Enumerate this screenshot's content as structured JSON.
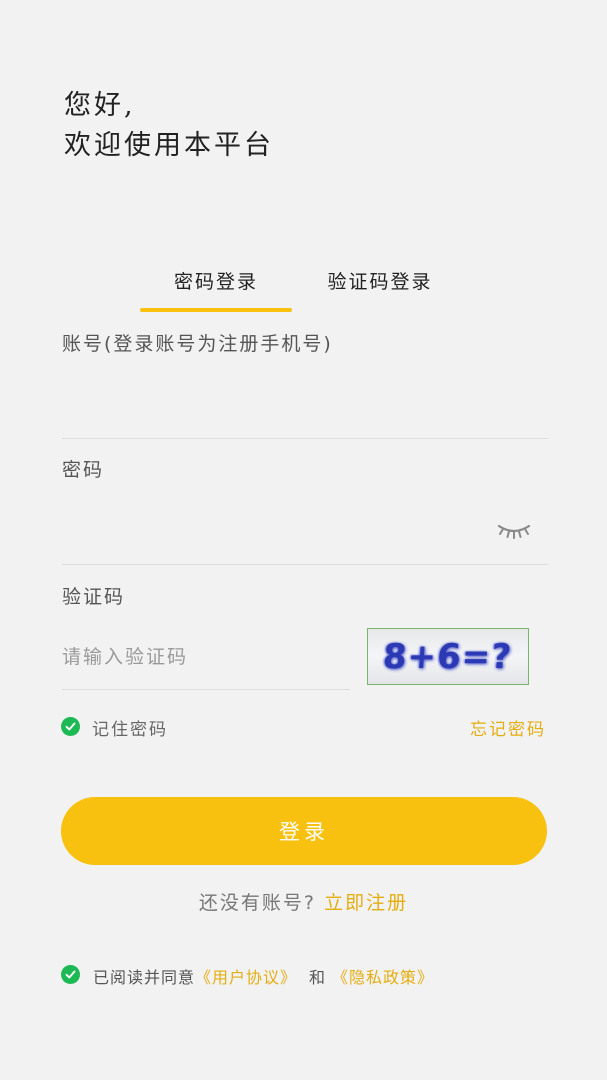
{
  "greeting": {
    "line1": "您好,",
    "line2": "欢迎使用本平台"
  },
  "tabs": [
    {
      "label": "密码登录",
      "active": true
    },
    {
      "label": "验证码登录",
      "active": false
    }
  ],
  "account": {
    "label": "账号(登录账号为注册手机号)",
    "value": "",
    "placeholder": ""
  },
  "password": {
    "label": "密码",
    "value": "",
    "placeholder": "",
    "toggle_icon": "eye-closed-icon"
  },
  "captcha": {
    "label": "验证码",
    "value": "",
    "placeholder": "请输入验证码",
    "image_text": "8+6=?"
  },
  "remember": {
    "label": "记住密码",
    "checked": true
  },
  "forgot": {
    "label": "忘记密码"
  },
  "login_button": {
    "label": "登录"
  },
  "register": {
    "prompt": "还没有账号?",
    "link": "立即注册"
  },
  "agreement": {
    "checked": true,
    "prefix": "已阅读并同意",
    "user_agreement": "《用户协议》",
    "and": "和",
    "privacy_policy": "《隐私政策》"
  },
  "colors": {
    "accent": "#f9c10f",
    "link": "#e4ad10",
    "check": "#1db954",
    "background": "#f2f2f2"
  }
}
